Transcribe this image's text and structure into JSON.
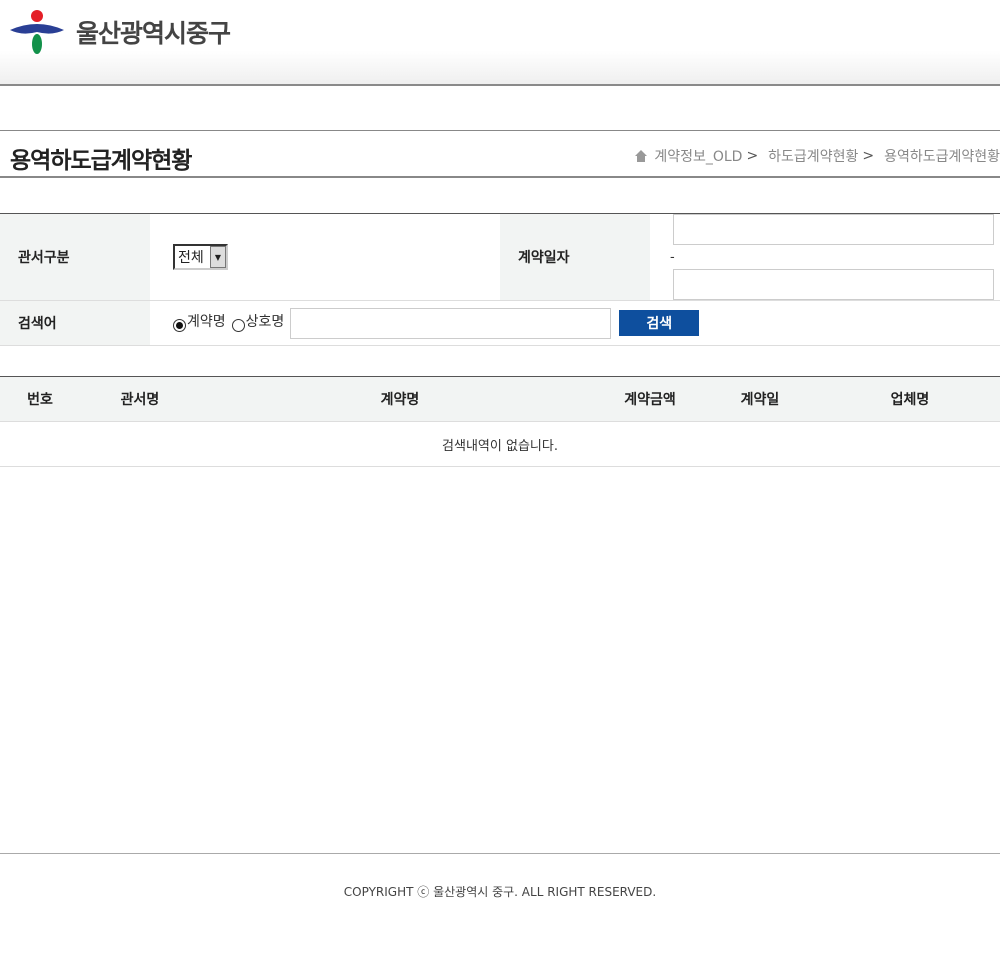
{
  "header": {
    "logo_text": "울산광역시중구"
  },
  "title_bar": {
    "page_title": "용역하도급계약현황",
    "breadcrumb": [
      "계약정보_OLD",
      "하도급계약현황",
      "용역하도급계약현황"
    ],
    "breadcrumb_separator": ">"
  },
  "search": {
    "office_label": "관서구분",
    "office_selected": "전체",
    "date_label": "계약일자",
    "date_separator": "-",
    "keyword_label": "검색어",
    "radio_options": [
      "계약명",
      "상호명"
    ],
    "radio_selected": "계약명",
    "search_button": "검색"
  },
  "list": {
    "columns": [
      "번호",
      "관서명",
      "계약명",
      "계약금액",
      "계약일",
      "업체명"
    ],
    "empty_message": "검색내역이 없습니다."
  },
  "footer": {
    "copyright": "COPYRIGHT ⓒ 울산광역시 중구. ALL RIGHT RESERVED."
  },
  "colors": {
    "accent": "#0e4f9e",
    "header_bg": "#f2f4f3",
    "logo_red": "#e41f27",
    "logo_blue": "#2a3f95",
    "logo_green": "#12914a"
  }
}
